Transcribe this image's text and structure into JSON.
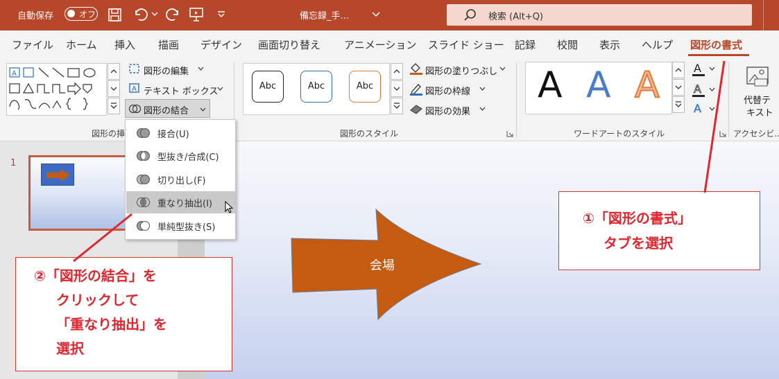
{
  "titlebar": {
    "autosave_label": "自動保存",
    "autosave_state": "オフ",
    "doc_title": "備忘録_手…",
    "search_placeholder": "検索 (Alt+Q)"
  },
  "tabs": [
    "ファイル",
    "ホーム",
    "挿入",
    "描画",
    "デザイン",
    "画面切り替え",
    "アニメーション",
    "スライド ショー",
    "記録",
    "校閲",
    "表示",
    "ヘルプ",
    "図形の書式"
  ],
  "active_tab": "図形の書式",
  "ribbon": {
    "insert_shapes": {
      "edit_shape": "図形の編集",
      "text_box": "テキスト ボックス",
      "merge_shapes": "図形の結合",
      "group_label": "図形の挿入"
    },
    "shape_styles": {
      "preset_label": "Abc",
      "fill": "図形の塗りつぶし",
      "outline": "図形の枠線",
      "effects": "図形の効果",
      "group_label": "図形のスタイル"
    },
    "wordart": {
      "letter": "A",
      "group_label": "ワードアートのスタイル"
    },
    "accessibility": {
      "alt_text_line1": "代替テ",
      "alt_text_line2": "キスト",
      "group_label": "アクセシビ..."
    }
  },
  "merge_menu": {
    "items": [
      {
        "label": "接合(U)",
        "highlighted": false
      },
      {
        "label": "型抜き/合成(C)",
        "highlighted": false
      },
      {
        "label": "切り出し(F)",
        "highlighted": false
      },
      {
        "label": "重なり抽出(I)",
        "highlighted": true
      },
      {
        "label": "単純型抜き(S)",
        "highlighted": false
      }
    ]
  },
  "slides": {
    "thumb_number": "1"
  },
  "slide": {
    "arrow_text": "会場"
  },
  "callouts": {
    "c1": {
      "line1": "①「図形の書式」",
      "line2": "タブを選択"
    },
    "c2": {
      "line1": "②「図形の結合」を",
      "line2": "クリックして",
      "line3": "「重なり抽出」を",
      "line4": "選択"
    }
  },
  "colors": {
    "accent": "#b7472a",
    "arrow_fill": "#c55a11",
    "callout_red": "#e0262e"
  }
}
